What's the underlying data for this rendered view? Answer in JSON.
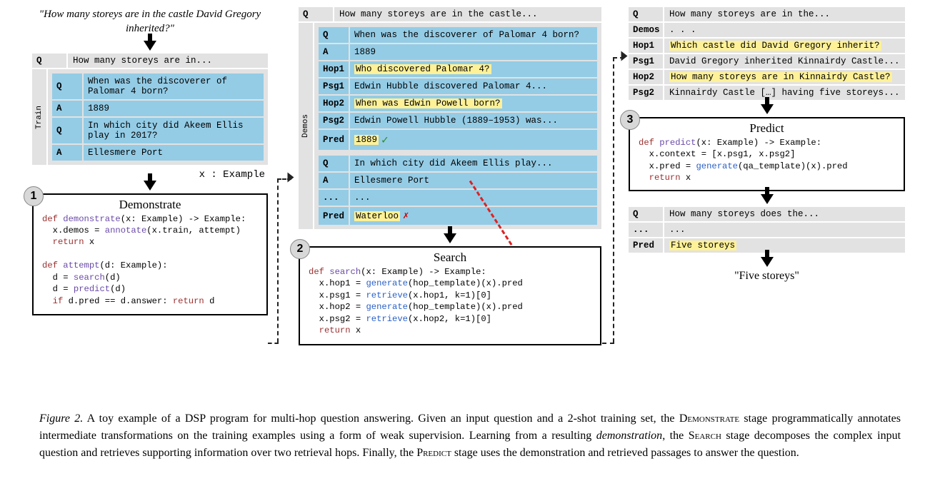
{
  "quote": "\"How many storeys are in the castle David Gregory inherited?\"",
  "col1": {
    "q_label": "Q",
    "q_text": "How many storeys are in...",
    "train_side": "Train",
    "train_rows": [
      {
        "label": "Q",
        "text": "When was the discoverer of Palomar 4 born?"
      },
      {
        "label": "A",
        "text": "1889"
      },
      {
        "label": "Q",
        "text": "In which city did Akeem Ellis play in 2017?"
      },
      {
        "label": "A",
        "text": "Ellesmere Port"
      }
    ],
    "x_example": "x : Example",
    "stage_num": "1",
    "stage_title": "Demonstrate"
  },
  "code1_l1_kw": "def",
  "code1_l1_fn": "demonstrate",
  "code1_l1_sig": "(x: Example) -> Example:",
  "code1_l2a": "  x.demos = ",
  "code1_l2_fn": "annotate",
  "code1_l2b": "(x.train, attempt)",
  "code1_l3_kw": "  return",
  "code1_l3b": " x",
  "code1_l5_kw": "def",
  "code1_l5_fn": "attempt",
  "code1_l5_sig": "(d: Example):",
  "code1_l6a": "  d = ",
  "code1_l6_fn": "search",
  "code1_l6b": "(d)",
  "code1_l7a": "  d = ",
  "code1_l7_fn": "predict",
  "code1_l7b": "(d)",
  "code1_l8_kw": "  if",
  "code1_l8a": " d.pred == d.answer: ",
  "code1_l8_kw2": "return",
  "code1_l8b": " d",
  "col2": {
    "q_label": "Q",
    "q_text": "How many storeys are in the castle...",
    "demos_side": "Demos",
    "block1": [
      {
        "label": "Q",
        "text": "When was the discoverer of Palomar 4 born?",
        "hl": false
      },
      {
        "label": "A",
        "text": "1889",
        "hl": false
      },
      {
        "label": "Hop1",
        "text": "Who discovered Palomar 4?",
        "hl": true
      },
      {
        "label": "Psg1",
        "text": "Edwin Hubble discovered Palomar 4...",
        "hl": false
      },
      {
        "label": "Hop2",
        "text": "When was Edwin Powell born?",
        "hl": true
      },
      {
        "label": "Psg2",
        "text": "Edwin Powell Hubble (1889–1953) was...",
        "hl": false
      },
      {
        "label": "Pred",
        "text": "1889",
        "hl": true,
        "check": true
      }
    ],
    "block2": [
      {
        "label": "Q",
        "text": "In which city did Akeem Ellis play..."
      },
      {
        "label": "A",
        "text": "Ellesmere Port"
      },
      {
        "label": "...",
        "text": "..."
      },
      {
        "label": "Pred",
        "text": "Waterloo",
        "hl": true,
        "cross": true
      }
    ],
    "stage_num": "2",
    "stage_title": "Search"
  },
  "code2_l1_kw": "def",
  "code2_l1_fn": "search",
  "code2_l1_sig": "(x: Example) -> Example:",
  "code2_l2a": "  x.hop1 = ",
  "code2_l2_fn": "generate",
  "code2_l2b": "(hop_template)(x).pred",
  "code2_l3a": "  x.psg1 = ",
  "code2_l3_fn": "retrieve",
  "code2_l3b": "(x.hop1, k=1)[0]",
  "code2_l4a": "  x.hop2 = ",
  "code2_l4_fn": "generate",
  "code2_l4b": "(hop_template)(x).pred",
  "code2_l5a": "  x.psg2 = ",
  "code2_l5_fn": "retrieve",
  "code2_l5b": "(x.hop2, k=1)[0]",
  "code2_l6_kw": "  return",
  "code2_l6b": " x",
  "col3": {
    "rows": [
      {
        "label": "Q",
        "text": "How many storeys are in the..."
      },
      {
        "label": "Demos",
        "text": ". . ."
      },
      {
        "label": "Hop1",
        "text": "Which castle did David Gregory inherit?",
        "hl": true
      },
      {
        "label": "Psg1",
        "text": "David Gregory inherited Kinnairdy Castle..."
      },
      {
        "label": "Hop2",
        "text": "How many storeys are in Kinnairdy Castle?",
        "hl": true
      },
      {
        "label": "Psg2",
        "text": "Kinnairdy Castle […] having five storeys..."
      }
    ],
    "stage_num": "3",
    "stage_title": "Predict",
    "rows2": [
      {
        "label": "Q",
        "text": "How many storeys does the..."
      },
      {
        "label": "...",
        "text": "..."
      },
      {
        "label": "Pred",
        "text": "Five storeys",
        "hl": true
      }
    ],
    "final": "\"Five storeys\""
  },
  "code3_l1_kw": "def",
  "code3_l1_fn": "predict",
  "code3_l1_sig": "(x: Example) -> Example:",
  "code3_l2": "  x.context = [x.psg1, x.psg2]",
  "code3_l3a": "  x.pred = ",
  "code3_l3_fn": "generate",
  "code3_l3b": "(qa_template)(x).pred",
  "code3_l4_kw": "  return",
  "code3_l4b": " x",
  "caption_fig": "Figure 2.",
  "caption_a": " A toy example of a DSP program for multi-hop question answering. Given an input question and a 2-shot training set, the ",
  "caption_demo": "Demonstrate",
  "caption_b": " stage programmatically annotates intermediate transformations on the training examples using a form of weak supervision. Learning from a resulting ",
  "caption_demoit": "demonstration",
  "caption_c": ", the ",
  "caption_search": "Search",
  "caption_d": " stage decomposes the complex input question and retrieves supporting information over two retrieval hops. Finally, the ",
  "caption_predict": "Predict",
  "caption_e": " stage uses the demonstration and retrieved passages to answer the question."
}
